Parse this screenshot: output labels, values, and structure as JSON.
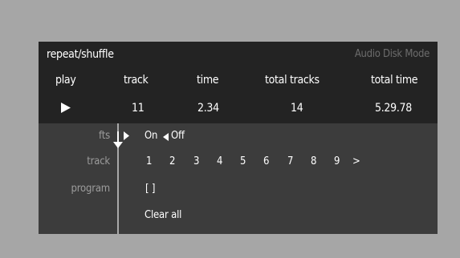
{
  "header": {
    "title": "repeat/shuffle",
    "mode": "Audio Disk Mode"
  },
  "status": {
    "columns": [
      "play",
      "track",
      "time",
      "total tracks",
      "total time"
    ],
    "values": {
      "play_icon": "play-icon",
      "track": "11",
      "time": "2.34",
      "total_tracks": "14",
      "total_time": "5.29.78"
    }
  },
  "settings": {
    "fts": {
      "label": "fts",
      "on": "On",
      "arrow": "◀",
      "off": "Off"
    },
    "track": {
      "label": "track",
      "numbers": [
        "1",
        "2",
        "3",
        "4",
        "5",
        "6",
        "7",
        "8",
        "9"
      ],
      "next": ">"
    },
    "program": {
      "label": "program",
      "value": "[ ]",
      "clear": "Clear all"
    }
  },
  "colors": {
    "background": "#a6a6a6",
    "panel_top": "#232323",
    "panel_bottom": "#3c3c3c",
    "label_gray": "#9c9c9c",
    "mode_gray": "#6c6c6c"
  }
}
